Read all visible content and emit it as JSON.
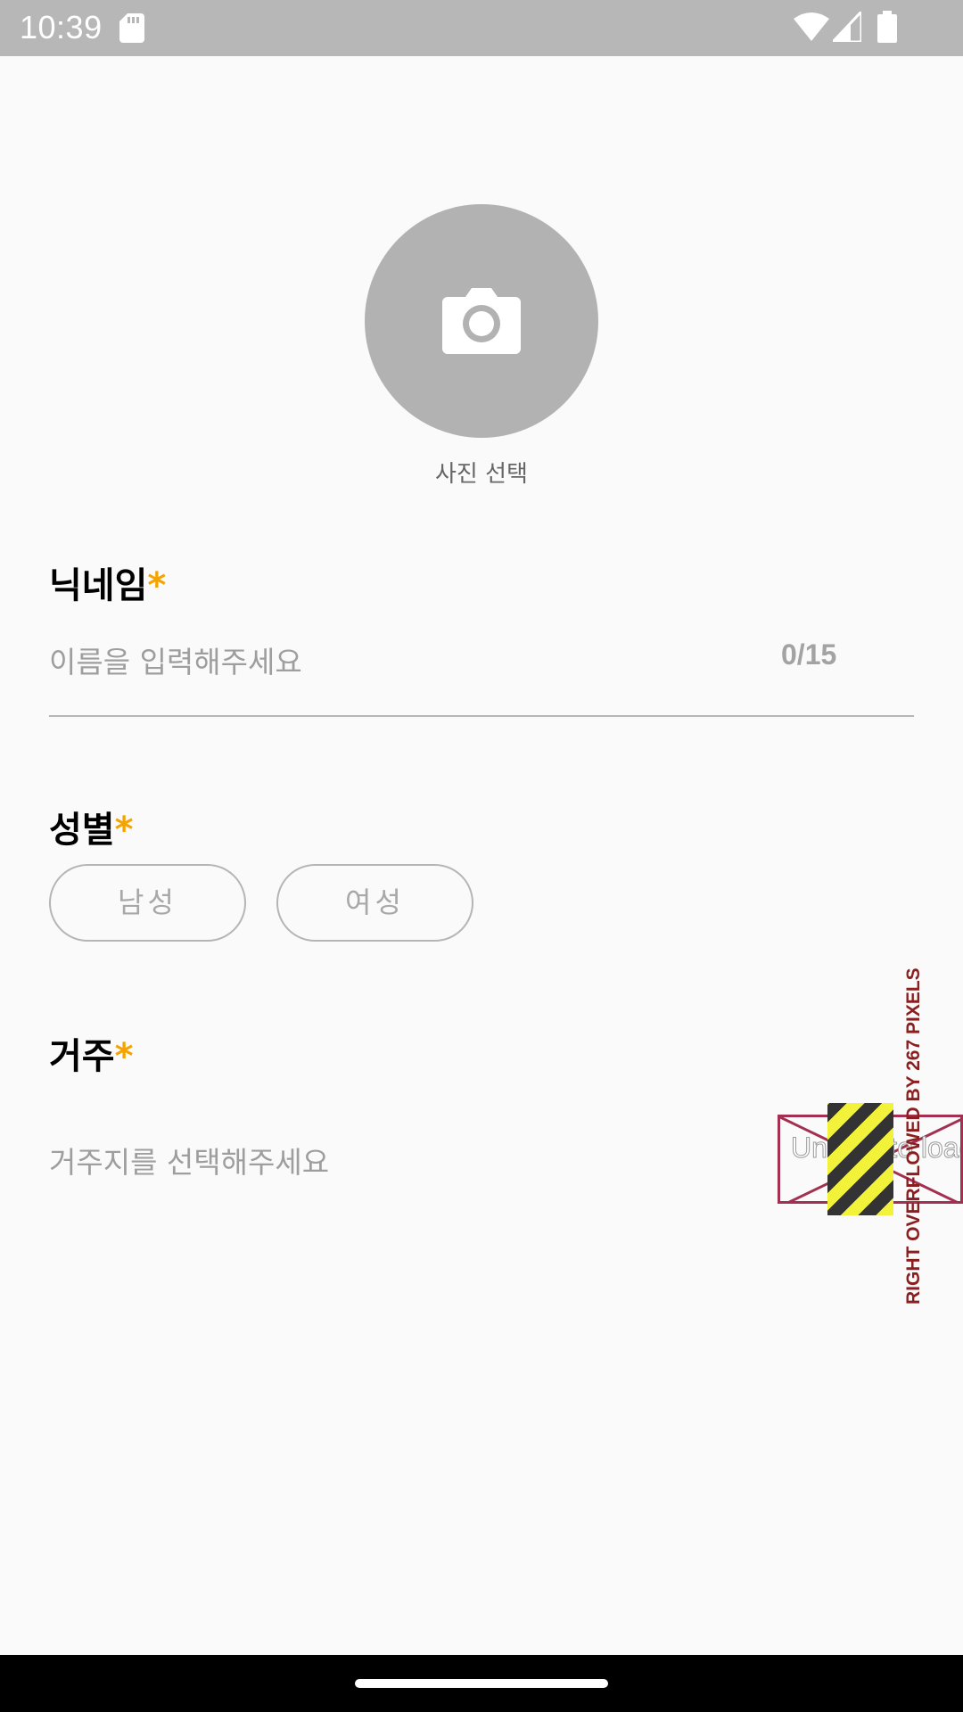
{
  "status_bar": {
    "time": "10:39",
    "icons": [
      "sd-card-icon",
      "wifi-icon",
      "cell-signal-icon",
      "battery-icon"
    ]
  },
  "profile": {
    "avatar_icon": "camera-icon",
    "photo_caption": "사진 선택"
  },
  "nickname": {
    "label": "닉네임",
    "required": "*",
    "placeholder": "이름을 입력해주세요",
    "value": "",
    "counter": "0/15"
  },
  "gender": {
    "label": "성별",
    "required": "*",
    "options": [
      "남성",
      "여성"
    ]
  },
  "residence": {
    "label": "거주",
    "required": "*",
    "placeholder": "거주지를 선택해주세요"
  },
  "overflow_warning": {
    "partial_text": "Unable to load",
    "banner": "RIGHT OVERFLOWED BY 267 PIXELS"
  },
  "colors": {
    "accent": "#f5a300",
    "status_bar": "#b7b7b7",
    "avatar": "#b2b2b2",
    "error": "#a33050"
  }
}
